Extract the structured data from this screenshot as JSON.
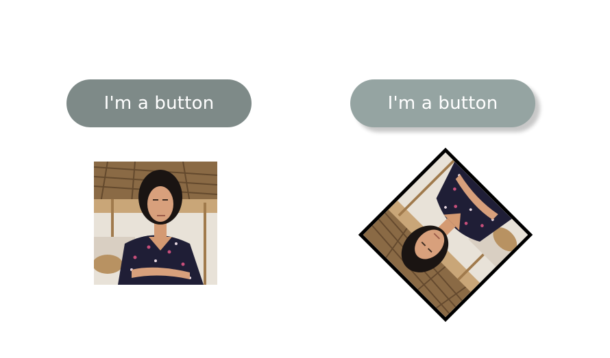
{
  "buttons": {
    "left": {
      "label": "I'm a button",
      "color": "#7e8a88"
    },
    "right": {
      "label": "I'm a button",
      "color": "#95a4a2"
    }
  },
  "images": {
    "left": {
      "subject": "portrait-photo"
    },
    "right": {
      "subject": "portrait-photo",
      "border_color": "#000000"
    }
  }
}
